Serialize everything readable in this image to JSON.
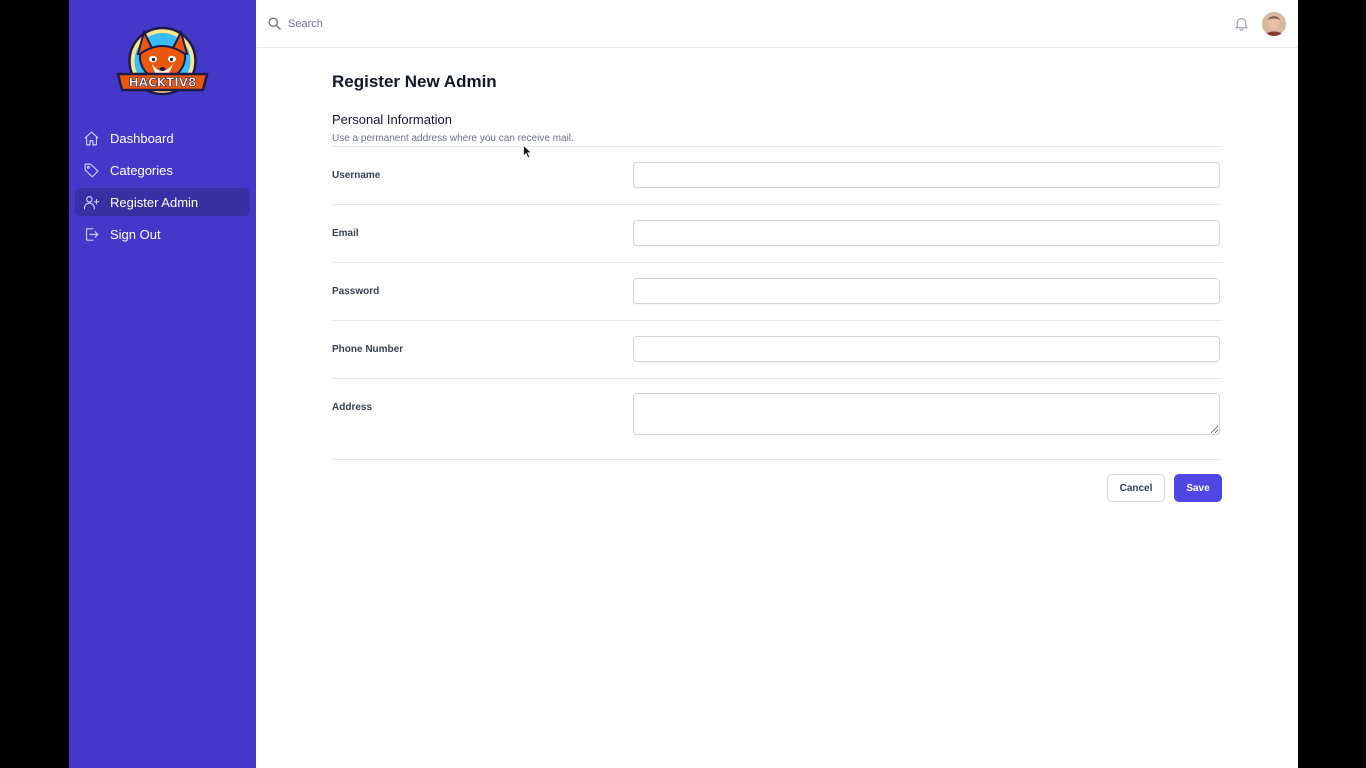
{
  "brand": {
    "logo_text": "HACKTIV8"
  },
  "colors": {
    "sidebar_bg": "#4338ca",
    "sidebar_active": "#3730a3",
    "primary_button": "#4f46e5"
  },
  "sidebar": {
    "items": [
      {
        "label": "Dashboard",
        "icon": "home-icon",
        "active": false
      },
      {
        "label": "Categories",
        "icon": "tag-icon",
        "active": false
      },
      {
        "label": "Register Admin",
        "icon": "user-add-icon",
        "active": true
      },
      {
        "label": "Sign Out",
        "icon": "logout-icon",
        "active": false
      }
    ]
  },
  "header": {
    "search_placeholder": "Search"
  },
  "main": {
    "page_title": "Register New Admin",
    "section_title": "Personal Information",
    "section_description": "Use a permanent address where you can receive mail.",
    "fields": [
      {
        "label": "Username",
        "value": ""
      },
      {
        "label": "Email",
        "value": ""
      },
      {
        "label": "Password",
        "value": ""
      },
      {
        "label": "Phone Number",
        "value": ""
      },
      {
        "label": "Address",
        "value": ""
      }
    ],
    "cancel_label": "Cancel",
    "save_label": "Save"
  }
}
